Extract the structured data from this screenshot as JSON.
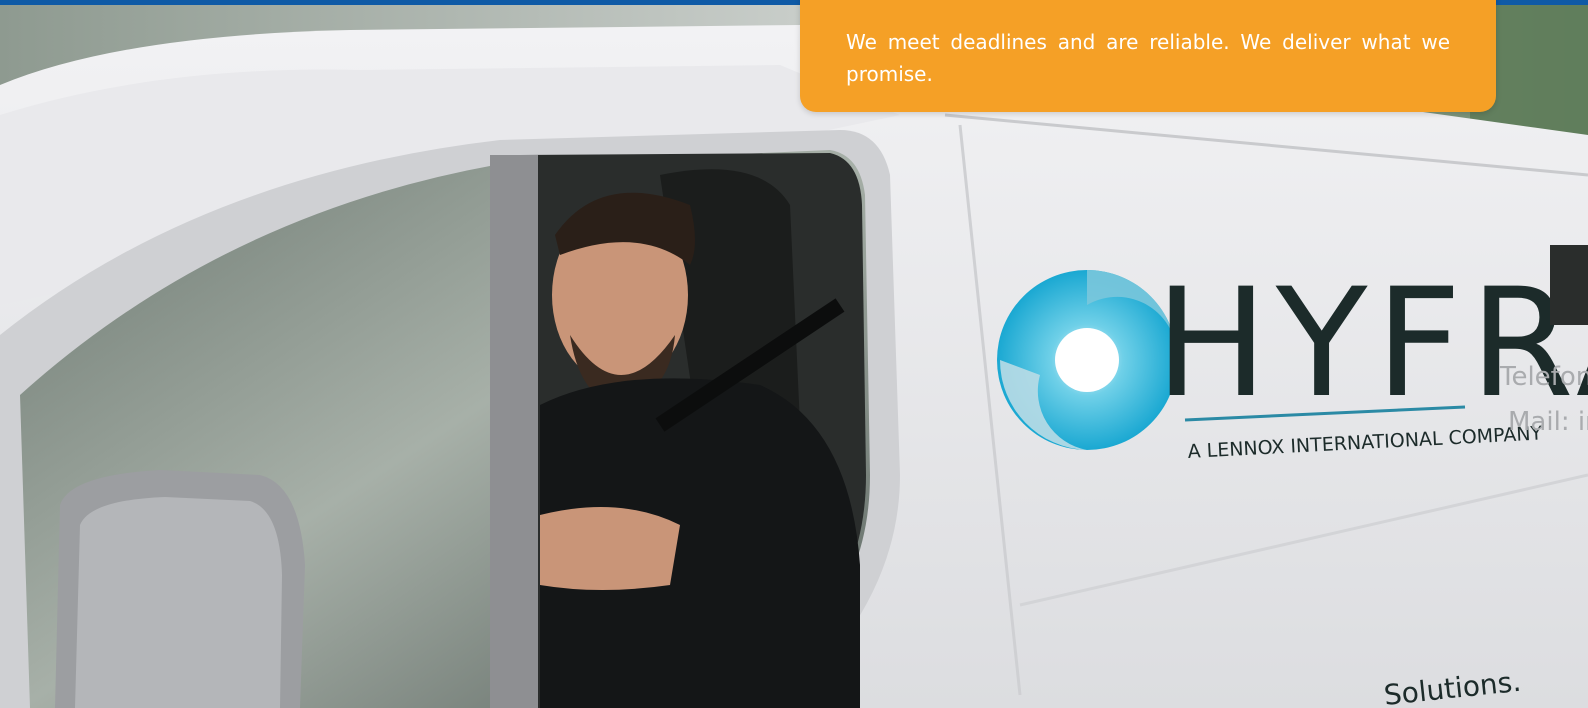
{
  "feature_card": {
    "text": "We meet deadlines and are reliable. We deliver what we promise."
  },
  "van": {
    "brand_name": "HYFRA",
    "tagline": "A LENNOX INTERNATIONAL COMPANY",
    "contact_phone_label": "Telefon:",
    "contact_mail_label": "Mail: info",
    "slogan_fragment": "Solutions."
  },
  "colors": {
    "accent_orange": "#f5a026",
    "top_bar_blue": "#0f5aa6",
    "logo_cyan": "#1fb4d8",
    "logo_dark": "#1c2b2a"
  }
}
